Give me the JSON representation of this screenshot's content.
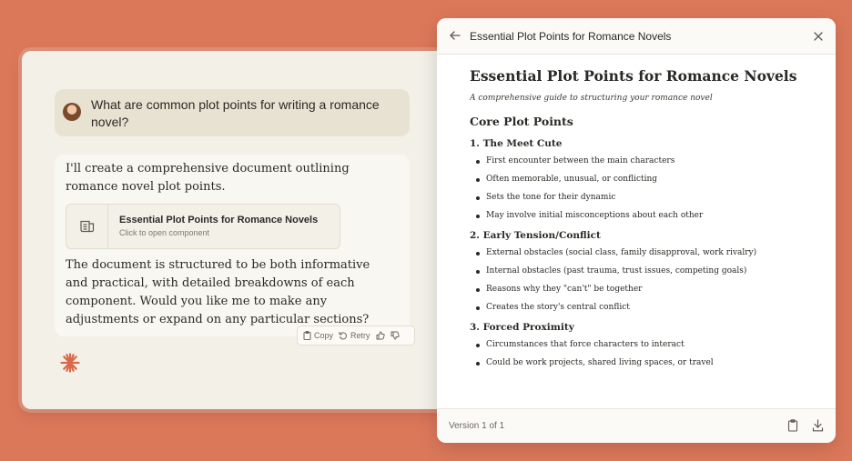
{
  "chat": {
    "user_message": "What are common plot points for writing a romance novel?",
    "assistant_intro": "I'll create a comprehensive document outlining romance novel plot points.",
    "artifact": {
      "title": "Essential Plot Points for Romance Novels",
      "subtitle": "Click to open component",
      "icon": "document-icon"
    },
    "assistant_body": "The document is structured to be both informative and practical, with detailed breakdowns of each component. Would you like me to make any adjustments or expand on any particular sections?",
    "actions": {
      "copy_label": "Copy",
      "retry_label": "Retry"
    },
    "logo_icon": "claude-spark-icon"
  },
  "panel": {
    "header_title": "Essential Plot Points for Romance Novels",
    "document": {
      "title": "Essential Plot Points for Romance Novels",
      "subtitle": "A comprehensive guide to structuring your romance novel",
      "section_heading": "Core Plot Points",
      "subsections": [
        {
          "heading": "1. The Meet Cute",
          "items": [
            "First encounter between the main characters",
            "Often memorable, unusual, or conflicting",
            "Sets the tone for their dynamic",
            "May involve initial misconceptions about each other"
          ]
        },
        {
          "heading": "2. Early Tension/Conflict",
          "items": [
            "External obstacles (social class, family disapproval, work rivalry)",
            "Internal obstacles (past trauma, trust issues, competing goals)",
            "Reasons why they \"can't\" be together",
            "Creates the story's central conflict"
          ]
        },
        {
          "heading": "3. Forced Proximity",
          "items": [
            "Circumstances that force characters to interact",
            "Could be work projects, shared living spaces, or travel"
          ]
        }
      ]
    },
    "footer": {
      "version_label": "Version 1 of 1"
    }
  },
  "colors": {
    "background": "#dc785a",
    "accent_spark": "#d9694a",
    "chat_bg": "#f3f0e8",
    "user_bubble": "#e8e2d2"
  }
}
